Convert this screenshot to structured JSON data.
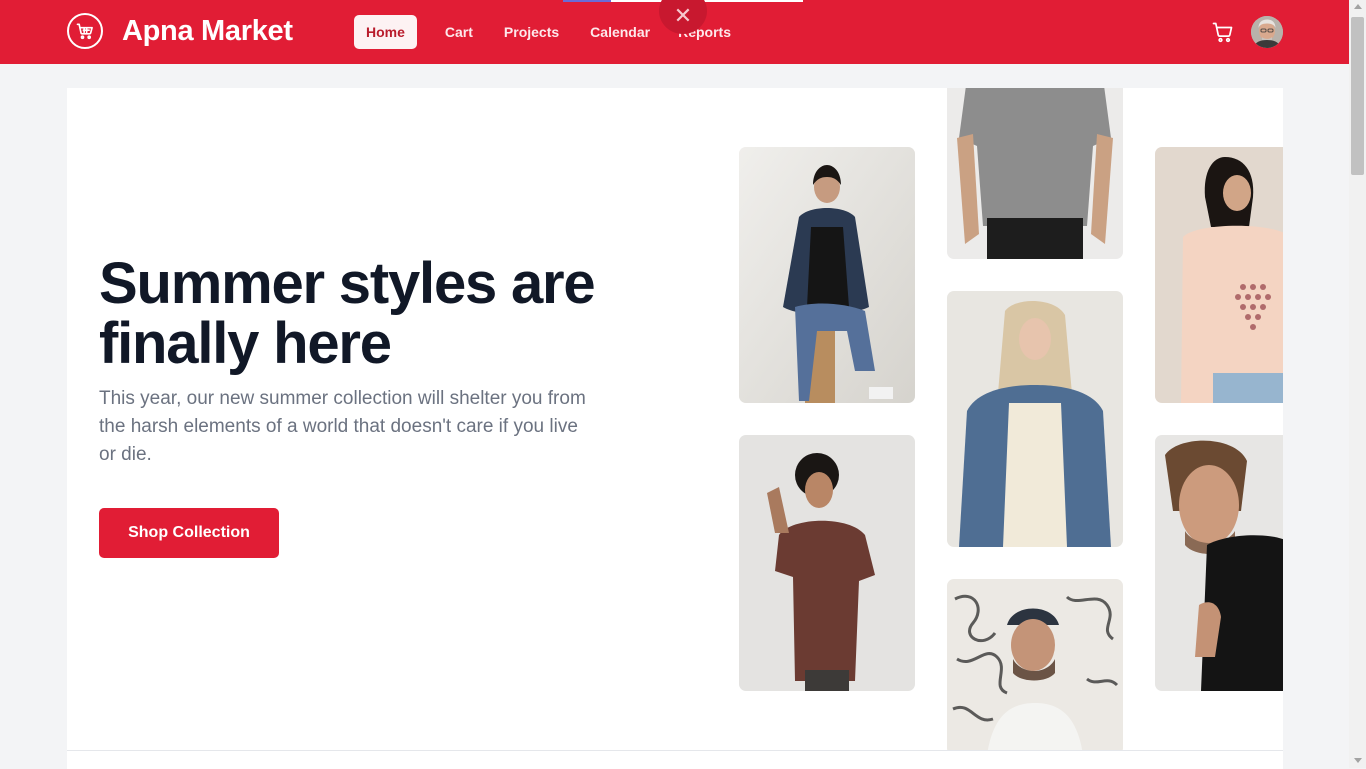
{
  "brand": {
    "name": "Apna Market",
    "logo_icon": "shopping-cart-icon"
  },
  "nav": [
    {
      "label": "Home",
      "active": true
    },
    {
      "label": "Cart",
      "active": false
    },
    {
      "label": "Projects",
      "active": false
    },
    {
      "label": "Calendar",
      "active": false
    },
    {
      "label": "Reports",
      "active": false
    }
  ],
  "overlay": {
    "close_glyph": "✕"
  },
  "header": {
    "cart_icon": "cart-icon",
    "avatar": "user-avatar"
  },
  "hero": {
    "title": "Summer styles are finally here",
    "description": "This year, our new summer collection will shelter you from the harsh elements of a world that doesn't care if you live or die.",
    "cta_label": "Shop Collection"
  },
  "colors": {
    "brand": "#e11d35",
    "heading": "#111827",
    "body_text": "#6b7280"
  },
  "gallery": [
    "woman-denim-jacket-photo",
    "man-curly-hair-brown-tee-photo",
    "grey-tee-torso-photo",
    "blonde-woman-denim-jacket-photo",
    "man-beanie-glasses-photo",
    "woman-pink-tee-photo",
    "man-black-tee-photo"
  ]
}
